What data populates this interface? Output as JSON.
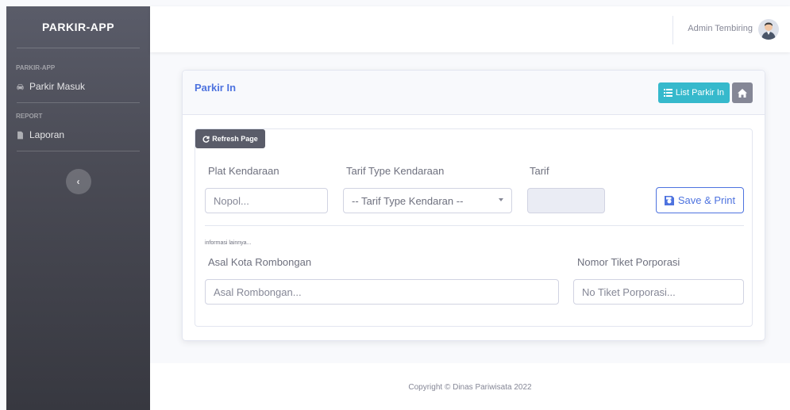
{
  "sidebar": {
    "brand": "PARKIR-APP",
    "heading_1": "PARKIR-APP",
    "item_parkir_masuk": "Parkir Masuk",
    "heading_2": "REPORT",
    "item_laporan": "Laporan"
  },
  "topbar": {
    "user_name": "Admin Tembiring"
  },
  "card": {
    "title": "Parkir In",
    "list_button": "List Parkir In",
    "refresh_button": "Refresh Page",
    "label_plat": "Plat Kendaraan",
    "placeholder_plat": "Nopol...",
    "label_tarif_type": "Tarif Type Kendaraan",
    "select_tarif_type": "-- Tarif Type Kendaran --",
    "label_tarif": "Tarif",
    "save_button": "Save & Print",
    "info_note": "informasi lainnya...",
    "label_asal": "Asal Kota Rombongan",
    "placeholder_asal": "Asal Rombongan...",
    "label_tiket": "Nomor Tiket Porporasi",
    "placeholder_tiket": "No Tiket Porporasi..."
  },
  "footer": {
    "copyright": "Copyright © Dinas Pariwisata 2022"
  },
  "colors": {
    "primary": "#4e73df",
    "info": "#36b9cc",
    "secondary": "#858796",
    "sidebar": "#5a5c69"
  }
}
